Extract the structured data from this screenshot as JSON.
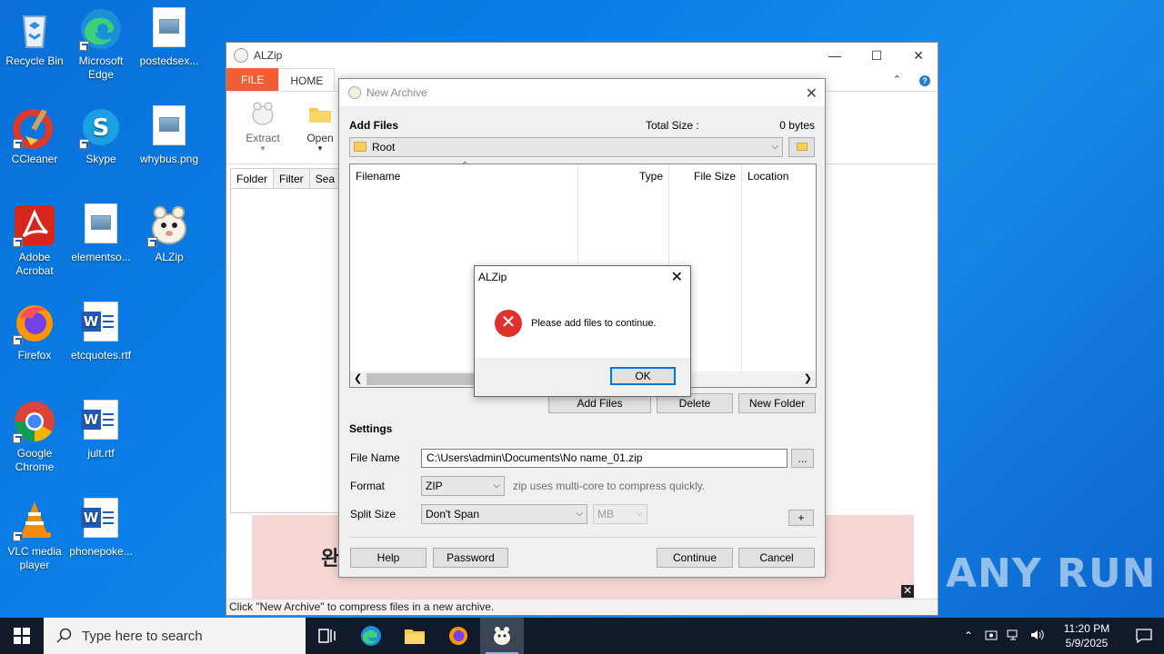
{
  "desktop": {
    "icons": [
      {
        "label": "Recycle Bin"
      },
      {
        "label": "Microsoft Edge"
      },
      {
        "label": "postedsex..."
      },
      {
        "label": "CCleaner"
      },
      {
        "label": "Skype"
      },
      {
        "label": "whybus.png"
      },
      {
        "label": "Adobe Acrobat"
      },
      {
        "label": "elementso..."
      },
      {
        "label": "ALZip"
      },
      {
        "label": "Firefox"
      },
      {
        "label": "etcquotes.rtf"
      },
      {
        "label": "Google Chrome"
      },
      {
        "label": "jult.rtf"
      },
      {
        "label": "VLC media player"
      },
      {
        "label": "phonepoke..."
      }
    ]
  },
  "alzip": {
    "title": "ALZip",
    "tabs": {
      "file": "FILE",
      "home": "HOME"
    },
    "ribbon": {
      "extract": "Extract",
      "open": "Open"
    },
    "side_tabs": {
      "folder": "Folder",
      "filter": "Filter",
      "search": "Sea"
    },
    "ad_text": "완",
    "status": "Click \"New Archive\" to compress files in a new archive."
  },
  "new_archive": {
    "title": "New Archive",
    "add_files_label": "Add Files",
    "total_size_label": "Total Size :",
    "total_size_value": "0 bytes",
    "folder_value": "Root",
    "columns": {
      "filename": "Filename",
      "type": "Type",
      "file_size": "File Size",
      "location": "Location"
    },
    "buttons": {
      "add_files": "Add Files",
      "delete": "Delete",
      "new_folder": "New Folder",
      "help": "Help",
      "password": "Password",
      "continue": "Continue",
      "cancel": "Cancel",
      "browse": "...",
      "plus": "+"
    },
    "settings_label": "Settings",
    "file_name_label": "File Name",
    "file_name_value": "C:\\Users\\admin\\Documents\\No name_01.zip",
    "format_label": "Format",
    "format_value": "ZIP",
    "format_hint": "zip uses multi-core to compress quickly.",
    "split_label": "Split Size",
    "split_value": "Don't Span",
    "split_unit": "MB"
  },
  "message_box": {
    "title": "ALZip",
    "message": "Please add files to continue.",
    "ok": "OK",
    "icon": "error-icon"
  },
  "taskbar": {
    "search_placeholder": "Type here to search",
    "time": "11:20 PM",
    "date": "5/9/2025"
  },
  "watermark": "ANY RUN"
}
